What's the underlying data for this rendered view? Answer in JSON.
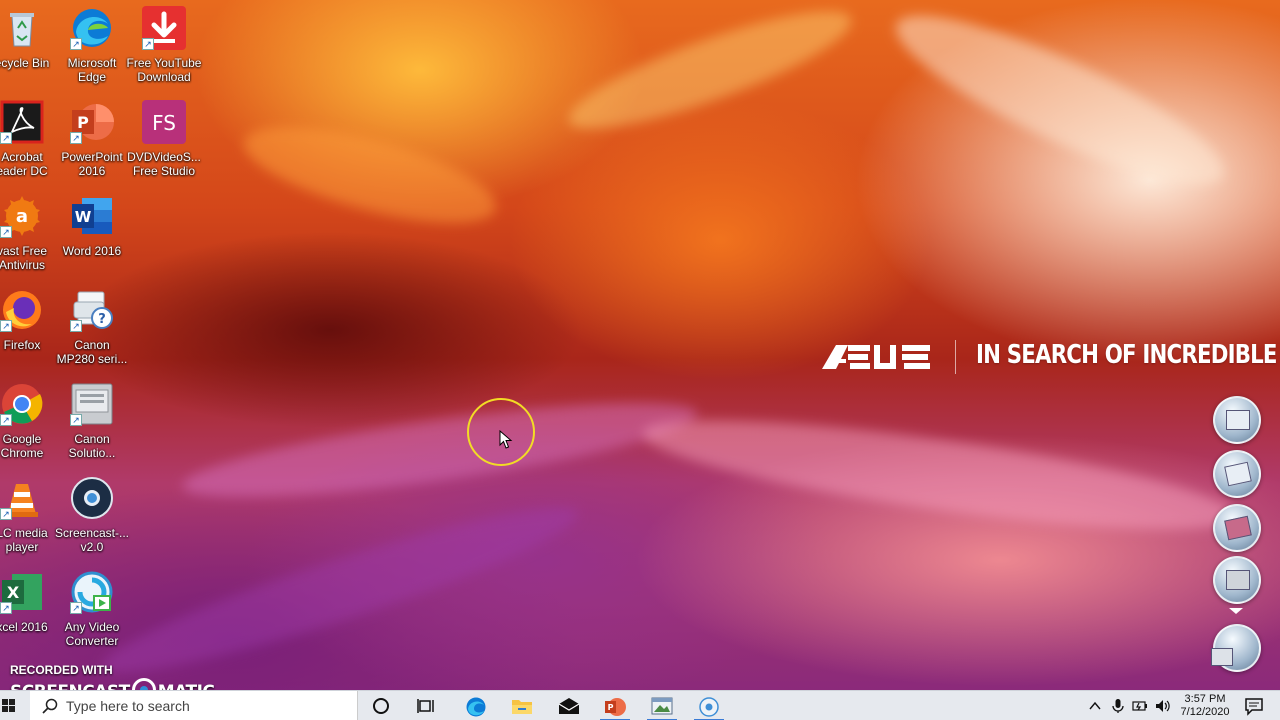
{
  "wallpaper": {
    "brand": "ASUS",
    "slogan": "IN SEARCH OF INCREDIBLE"
  },
  "desktop_icons": [
    {
      "name": "recycle-bin",
      "label1": "ecycle Bin",
      "label2": "",
      "icon": "recycle-bin-icon"
    },
    {
      "name": "microsoft-edge",
      "label1": "Microsoft",
      "label2": "Edge",
      "icon": "edge-icon"
    },
    {
      "name": "free-youtube-download",
      "label1": "Free YouTube",
      "label2": "Download",
      "icon": "download-arrow-icon"
    },
    {
      "name": "acrobat-reader",
      "label1": "Acrobat",
      "label2": "eader DC",
      "icon": "acrobat-icon"
    },
    {
      "name": "powerpoint-2016",
      "label1": "PowerPoint",
      "label2": "2016",
      "icon": "powerpoint-icon"
    },
    {
      "name": "dvdvideosoft",
      "label1": "DVDVideoS...",
      "label2": "Free Studio",
      "icon": "fs-icon"
    },
    {
      "name": "avast",
      "label1": "vast Free",
      "label2": "Antivirus",
      "icon": "avast-icon"
    },
    {
      "name": "word-2016",
      "label1": "Word 2016",
      "label2": "",
      "icon": "word-icon"
    },
    {
      "name": "firefox",
      "label1": "Firefox",
      "label2": "",
      "icon": "firefox-icon"
    },
    {
      "name": "canon-mp280",
      "label1": "Canon",
      "label2": "MP280 seri...",
      "icon": "printer-help-icon"
    },
    {
      "name": "google-chrome",
      "label1": "Google",
      "label2": "Chrome",
      "icon": "chrome-icon"
    },
    {
      "name": "canon-solution",
      "label1": "Canon",
      "label2": "Solutio...",
      "icon": "solution-menu-icon"
    },
    {
      "name": "vlc",
      "label1": "LC media",
      "label2": "player",
      "icon": "vlc-cone-icon"
    },
    {
      "name": "screencast-o-matic",
      "label1": "Screencast-...",
      "label2": "v2.0",
      "icon": "screencast-icon"
    },
    {
      "name": "excel-2016",
      "label1": "xcel 2016",
      "label2": "",
      "icon": "excel-icon"
    },
    {
      "name": "any-video-converter",
      "label1": "Any Video",
      "label2": "Converter",
      "icon": "video-converter-icon"
    }
  ],
  "watermark": {
    "line1": "RECORDED WITH",
    "brand_left": "SCREENCAST",
    "brand_right": "MATIC"
  },
  "taskbar": {
    "search_placeholder": "Type here to search",
    "apps": [
      "cortana-icon",
      "task-view-icon",
      "edge-icon",
      "file-explorer-icon",
      "mail-icon",
      "powerpoint-icon",
      "photo-viewer-icon",
      "screencast-icon"
    ],
    "clock_time": "3:57 PM",
    "clock_date": "7/12/2020"
  },
  "colors": {
    "taskbar_bg": "#e6e9ee",
    "cursor_ring": "#f2dc25",
    "edge_blue": "#0c7bd6",
    "powerpoint_orange": "#d24726",
    "word_blue": "#2b579a",
    "excel_green": "#217346"
  }
}
